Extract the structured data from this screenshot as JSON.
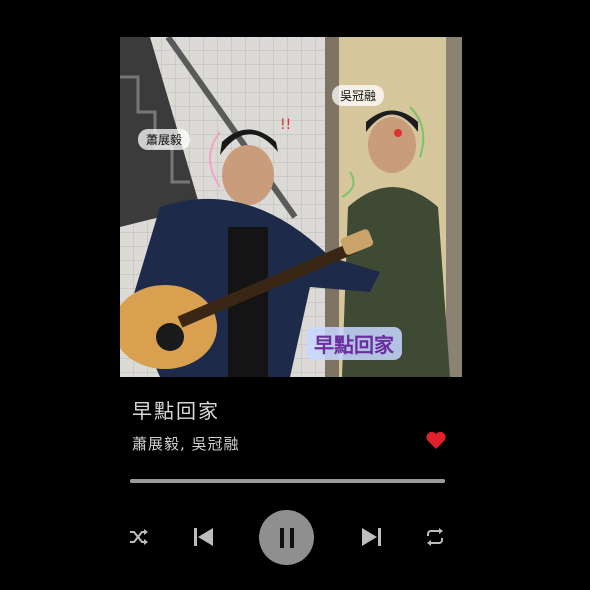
{
  "artwork": {
    "label_left": "蕭展毅",
    "label_right": "吳冠融",
    "title_overlay": "早點回家"
  },
  "track": {
    "title": "早點回家",
    "artists": "蕭展毅, 吳冠融",
    "liked": true
  },
  "progress": {
    "fraction": 1.0
  },
  "controls": {
    "shuffle": "shuffle-icon",
    "previous": "skip-previous-icon",
    "play_state": "pause-icon",
    "next": "skip-next-icon",
    "repeat": "repeat-icon"
  },
  "colors": {
    "background": "#000000",
    "heart": "#e0202a",
    "progress": "#8d8d8d",
    "play_button": "#8f8f8f"
  }
}
